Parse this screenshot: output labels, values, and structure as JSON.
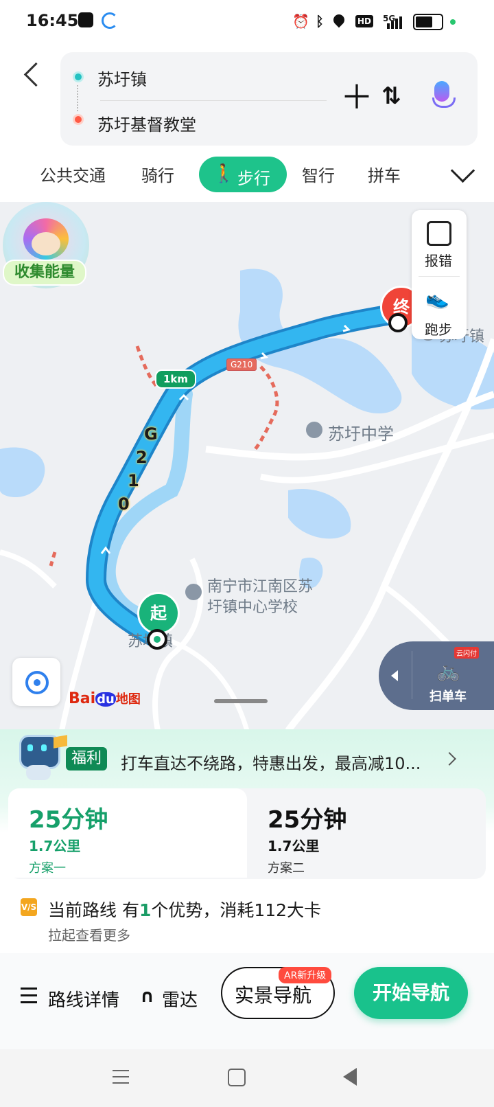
{
  "status_bar": {
    "time": "16:45",
    "network": "5G",
    "hd": "HD"
  },
  "search": {
    "origin": "苏圩镇",
    "destination": "苏圩基督教堂"
  },
  "modes": {
    "transit": "公共交通",
    "cycling": "骑行",
    "walking": "步行",
    "smart": "智行",
    "carpool": "拼车"
  },
  "map": {
    "collect_energy": "收集能量",
    "report_error": "报错",
    "running": "跑步",
    "end_marker": "终",
    "start_marker": "起",
    "distance_marker": "1km",
    "road_shield": "G210",
    "road_label_chars": [
      "G",
      "2",
      "1",
      "0"
    ],
    "poi_middle_school": "苏圩中学",
    "poi_primary_school_line1": "南宁市江南区苏",
    "poi_primary_school_line2": "圩镇中心学校",
    "poi_town": "苏圩镇",
    "poi_partial": "苏圩镇",
    "brand_bai": "Bai",
    "brand_du": "du",
    "brand_map": "地图",
    "scan_bike": "扫单车",
    "pay_badge": "云闪付"
  },
  "promo": {
    "tag": "福利",
    "text": "打车直达不绕路，特惠出发，最高减10..."
  },
  "plans": [
    {
      "duration": "25分钟",
      "distance": "1.7公里",
      "name": "方案一"
    },
    {
      "duration": "25分钟",
      "distance": "1.7公里",
      "name": "方案二"
    }
  ],
  "advantage": {
    "prefix": "当前路线 有",
    "count": "1",
    "suffix": "个优势，消耗112大卡",
    "hint": "拉起查看更多",
    "icon_text": "V/S"
  },
  "actions": {
    "route_details": "路线详情",
    "radar": "雷达",
    "ar_nav": "实景导航",
    "ar_tag": "AR新升级",
    "start_nav": "开始导航"
  },
  "colors": {
    "accent": "#1ec38b",
    "route": "#29aee8",
    "end": "#f04438"
  }
}
